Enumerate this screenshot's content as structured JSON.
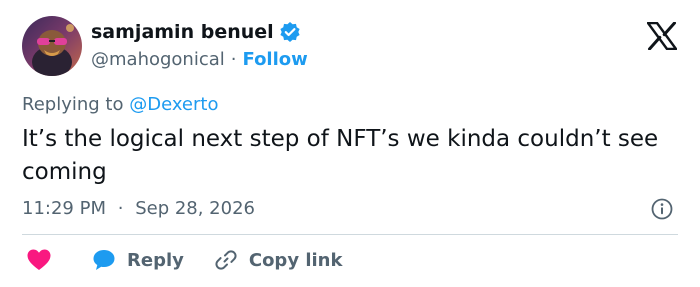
{
  "author": {
    "display_name": "samjamin benuel",
    "handle": "@mahogonical",
    "separator": "·",
    "follow_label": "Follow"
  },
  "reply_context": {
    "prefix": "Replying to",
    "mention": "@Dexerto"
  },
  "tweet": {
    "text": "It’s the logical next step of NFT’s we kinda couldn’t see coming",
    "time": "11:29 PM",
    "separator": "·",
    "date": "Sep 28, 2026"
  },
  "actions": {
    "reply_label": "Reply",
    "copy_link_label": "Copy link"
  },
  "colors": {
    "accent": "#1d9bf0",
    "like": "#f91880",
    "text": "#0f1419",
    "secondary": "#536471",
    "divider": "#cfd9de"
  },
  "icons": [
    "avatar-image",
    "verified-badge-icon",
    "x-logo-icon",
    "info-icon",
    "heart-icon",
    "reply-bubble-icon",
    "link-icon"
  ]
}
